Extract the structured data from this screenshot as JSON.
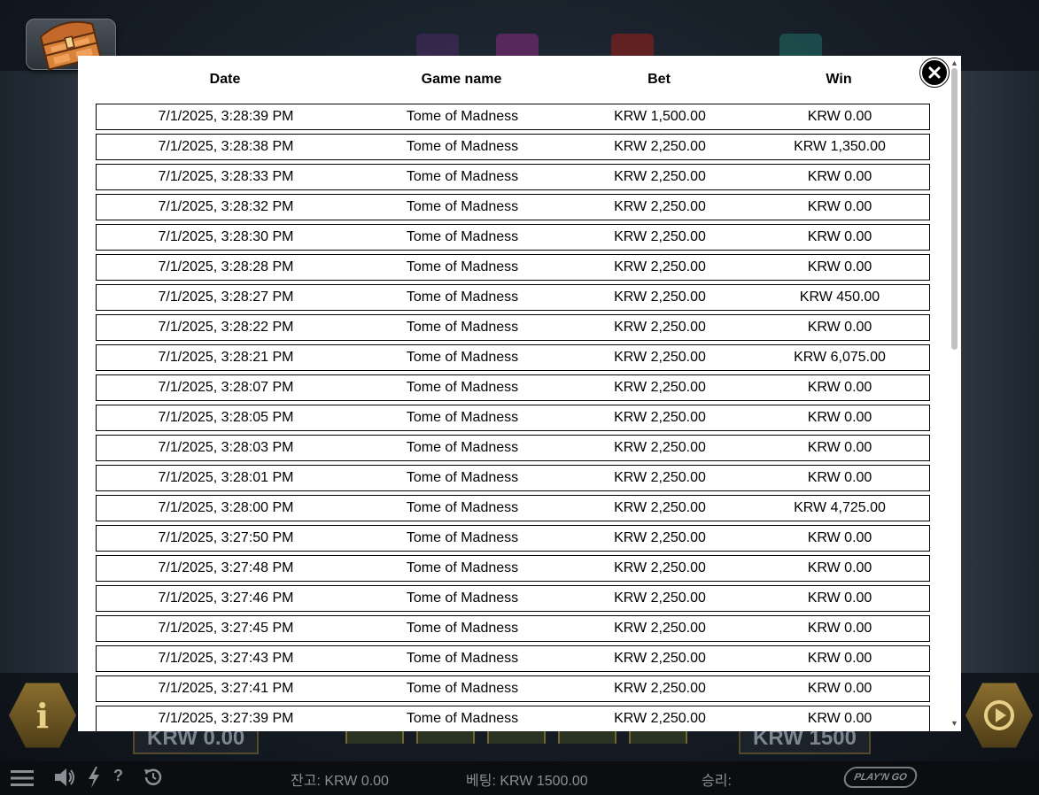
{
  "history": {
    "columns": {
      "date": "Date",
      "game": "Game name",
      "bet": "Bet",
      "win": "Win"
    },
    "rows": [
      {
        "date": "7/1/2025, 3:28:39 PM",
        "game": "Tome of Madness",
        "bet": "KRW 1,500.00",
        "win": "KRW 0.00"
      },
      {
        "date": "7/1/2025, 3:28:38 PM",
        "game": "Tome of Madness",
        "bet": "KRW 2,250.00",
        "win": "KRW 1,350.00"
      },
      {
        "date": "7/1/2025, 3:28:33 PM",
        "game": "Tome of Madness",
        "bet": "KRW 2,250.00",
        "win": "KRW 0.00"
      },
      {
        "date": "7/1/2025, 3:28:32 PM",
        "game": "Tome of Madness",
        "bet": "KRW 2,250.00",
        "win": "KRW 0.00"
      },
      {
        "date": "7/1/2025, 3:28:30 PM",
        "game": "Tome of Madness",
        "bet": "KRW 2,250.00",
        "win": "KRW 0.00"
      },
      {
        "date": "7/1/2025, 3:28:28 PM",
        "game": "Tome of Madness",
        "bet": "KRW 2,250.00",
        "win": "KRW 0.00"
      },
      {
        "date": "7/1/2025, 3:28:27 PM",
        "game": "Tome of Madness",
        "bet": "KRW 2,250.00",
        "win": "KRW 450.00"
      },
      {
        "date": "7/1/2025, 3:28:22 PM",
        "game": "Tome of Madness",
        "bet": "KRW 2,250.00",
        "win": "KRW 0.00"
      },
      {
        "date": "7/1/2025, 3:28:21 PM",
        "game": "Tome of Madness",
        "bet": "KRW 2,250.00",
        "win": "KRW 6,075.00"
      },
      {
        "date": "7/1/2025, 3:28:07 PM",
        "game": "Tome of Madness",
        "bet": "KRW 2,250.00",
        "win": "KRW 0.00"
      },
      {
        "date": "7/1/2025, 3:28:05 PM",
        "game": "Tome of Madness",
        "bet": "KRW 2,250.00",
        "win": "KRW 0.00"
      },
      {
        "date": "7/1/2025, 3:28:03 PM",
        "game": "Tome of Madness",
        "bet": "KRW 2,250.00",
        "win": "KRW 0.00"
      },
      {
        "date": "7/1/2025, 3:28:01 PM",
        "game": "Tome of Madness",
        "bet": "KRW 2,250.00",
        "win": "KRW 0.00"
      },
      {
        "date": "7/1/2025, 3:28:00 PM",
        "game": "Tome of Madness",
        "bet": "KRW 2,250.00",
        "win": "KRW 4,725.00"
      },
      {
        "date": "7/1/2025, 3:27:50 PM",
        "game": "Tome of Madness",
        "bet": "KRW 2,250.00",
        "win": "KRW 0.00"
      },
      {
        "date": "7/1/2025, 3:27:48 PM",
        "game": "Tome of Madness",
        "bet": "KRW 2,250.00",
        "win": "KRW 0.00"
      },
      {
        "date": "7/1/2025, 3:27:46 PM",
        "game": "Tome of Madness",
        "bet": "KRW 2,250.00",
        "win": "KRW 0.00"
      },
      {
        "date": "7/1/2025, 3:27:45 PM",
        "game": "Tome of Madness",
        "bet": "KRW 2,250.00",
        "win": "KRW 0.00"
      },
      {
        "date": "7/1/2025, 3:27:43 PM",
        "game": "Tome of Madness",
        "bet": "KRW 2,250.00",
        "win": "KRW 0.00"
      },
      {
        "date": "7/1/2025, 3:27:41 PM",
        "game": "Tome of Madness",
        "bet": "KRW 2,250.00",
        "win": "KRW 0.00"
      },
      {
        "date": "7/1/2025, 3:27:39 PM",
        "game": "Tome of Madness",
        "bet": "KRW 2,250.00",
        "win": "KRW 0.00"
      }
    ]
  },
  "game_bg": {
    "balance_box": "KRW 0.00",
    "bet_box": "KRW 1500",
    "info_glyph": "i"
  },
  "status_bar": {
    "balance": "잔고: KRW 0.00",
    "bet": "베팅: KRW 1500.00",
    "win": "승리:",
    "help_glyph": "?",
    "brand": "PLAY'N GO"
  },
  "icons": {
    "chest": "treasure-chest-icon",
    "close": "close-icon",
    "menu": "hamburger-menu-icon",
    "sound": "speaker-icon",
    "turbo": "lightning-icon",
    "history": "history-icon",
    "autoplay": "autoplay-icon"
  },
  "colors": {
    "modal_bg": "#ffffff",
    "status_bar_bg": "#0c0d10",
    "status_text": "#8b8e93",
    "chest_orange": "#d9823a"
  }
}
